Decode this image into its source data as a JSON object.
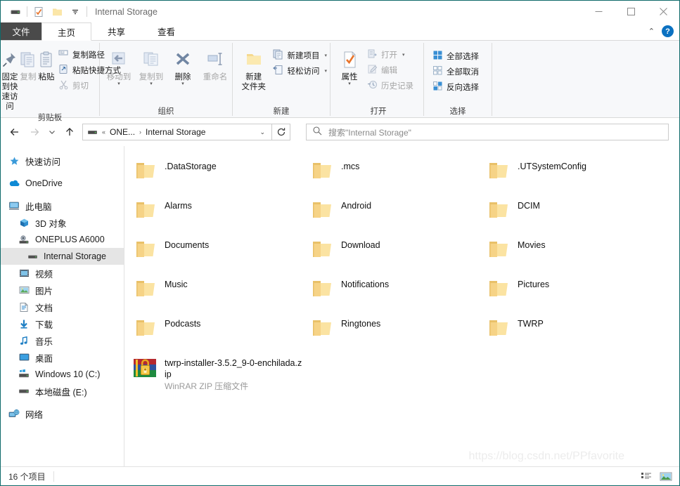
{
  "window": {
    "title": "Internal Storage",
    "quick_access": [
      "drive-icon",
      "properties-icon",
      "new-folder-icon",
      "customize-qat-icon"
    ],
    "controls": {
      "minimize": "minimize-icon",
      "maximize": "maximize-icon",
      "close": "close-icon"
    }
  },
  "tabs": {
    "file": "文件",
    "items": [
      {
        "label": "主页",
        "active": true
      },
      {
        "label": "共享",
        "active": false
      },
      {
        "label": "查看",
        "active": false
      }
    ],
    "collapse": "ribbon-collapse-icon",
    "help": "?"
  },
  "ribbon": {
    "groups": [
      {
        "label": "剪贴板",
        "big": [
          {
            "label": "固定到快\n速访问",
            "icon": "pin-icon",
            "disabled": false
          },
          {
            "label": "复制",
            "icon": "copy-icon",
            "disabled": true
          },
          {
            "label": "粘贴",
            "icon": "paste-icon",
            "disabled": false
          }
        ],
        "small": [
          {
            "label": "复制路径",
            "icon": "copy-path-icon",
            "disabled": false
          },
          {
            "label": "粘贴快捷方式",
            "icon": "paste-shortcut-icon",
            "disabled": false
          },
          {
            "label": "剪切",
            "icon": "cut-icon",
            "disabled": true
          }
        ]
      },
      {
        "label": "组织",
        "big": [
          {
            "label": "移动到",
            "icon": "move-to-icon",
            "disabled": true,
            "dropdown": true
          },
          {
            "label": "复制到",
            "icon": "copy-to-icon",
            "disabled": true,
            "dropdown": true
          },
          {
            "label": "删除",
            "icon": "delete-icon",
            "disabled": false,
            "dropdown": true
          },
          {
            "label": "重命名",
            "icon": "rename-icon",
            "disabled": true
          }
        ],
        "small": []
      },
      {
        "label": "新建",
        "big": [
          {
            "label": "新建\n文件夹",
            "icon": "new-folder-icon",
            "disabled": false
          }
        ],
        "small": [
          {
            "label": "新建项目",
            "icon": "new-item-icon",
            "disabled": false,
            "dropdown": true
          },
          {
            "label": "轻松访问",
            "icon": "easy-access-icon",
            "disabled": false,
            "dropdown": true
          }
        ]
      },
      {
        "label": "打开",
        "big": [
          {
            "label": "属性",
            "icon": "properties-icon",
            "disabled": false,
            "dropdown": true
          }
        ],
        "small": [
          {
            "label": "打开",
            "icon": "open-icon",
            "disabled": true,
            "dropdown": true
          },
          {
            "label": "编辑",
            "icon": "edit-icon",
            "disabled": true
          },
          {
            "label": "历史记录",
            "icon": "history-icon",
            "disabled": true
          }
        ]
      },
      {
        "label": "选择",
        "big": [],
        "small": [
          {
            "label": "全部选择",
            "icon": "select-all-icon",
            "disabled": false
          },
          {
            "label": "全部取消",
            "icon": "select-none-icon",
            "disabled": false
          },
          {
            "label": "反向选择",
            "icon": "invert-selection-icon",
            "disabled": false
          }
        ]
      }
    ]
  },
  "address": {
    "back": "back-arrow-icon",
    "forward": "forward-arrow-icon",
    "recent": "recent-locations-icon",
    "up": "up-arrow-icon",
    "icon": "drive-icon",
    "overflow": "«",
    "crumbs": [
      "ONE...",
      "Internal Storage"
    ],
    "separator": "›",
    "dropdown": "chevron-down-icon",
    "refresh": "refresh-icon"
  },
  "search": {
    "icon": "search-icon",
    "placeholder": "搜索\"Internal Storage\""
  },
  "sidebar": {
    "items": [
      {
        "label": "快速访问",
        "icon": "star-pin-icon",
        "indent": 0,
        "selected": false
      },
      {
        "label": "OneDrive",
        "icon": "onedrive-cloud-icon",
        "indent": 0,
        "selected": false
      },
      {
        "label": "此电脑",
        "icon": "this-pc-icon",
        "indent": 0,
        "selected": false
      },
      {
        "label": "3D 对象",
        "icon": "3d-objects-icon",
        "indent": 1,
        "selected": false
      },
      {
        "label": "ONEPLUS A6000",
        "icon": "phone-device-icon",
        "indent": 1,
        "selected": false
      },
      {
        "label": "Internal Storage",
        "icon": "drive-icon",
        "indent": 2,
        "selected": true
      },
      {
        "label": "视频",
        "icon": "videos-icon",
        "indent": 1,
        "selected": false
      },
      {
        "label": "图片",
        "icon": "pictures-icon",
        "indent": 1,
        "selected": false
      },
      {
        "label": "文档",
        "icon": "documents-icon",
        "indent": 1,
        "selected": false
      },
      {
        "label": "下载",
        "icon": "downloads-icon",
        "indent": 1,
        "selected": false
      },
      {
        "label": "音乐",
        "icon": "music-icon",
        "indent": 1,
        "selected": false
      },
      {
        "label": "桌面",
        "icon": "desktop-icon",
        "indent": 1,
        "selected": false
      },
      {
        "label": "Windows 10 (C:)",
        "icon": "windows-drive-icon",
        "indent": 1,
        "selected": false
      },
      {
        "label": "本地磁盘 (E:)",
        "icon": "drive-icon",
        "indent": 1,
        "selected": false
      },
      {
        "label": "网络",
        "icon": "network-icon",
        "indent": 0,
        "selected": false
      }
    ]
  },
  "files": [
    {
      "name": ".DataStorage",
      "type": "folder",
      "sub": ""
    },
    {
      "name": ".mcs",
      "type": "folder",
      "sub": ""
    },
    {
      "name": ".UTSystemConfig",
      "type": "folder",
      "sub": ""
    },
    {
      "name": "Alarms",
      "type": "folder",
      "sub": ""
    },
    {
      "name": "Android",
      "type": "folder",
      "sub": ""
    },
    {
      "name": "DCIM",
      "type": "folder",
      "sub": ""
    },
    {
      "name": "Documents",
      "type": "folder",
      "sub": ""
    },
    {
      "name": "Download",
      "type": "folder",
      "sub": ""
    },
    {
      "name": "Movies",
      "type": "folder",
      "sub": ""
    },
    {
      "name": "Music",
      "type": "folder",
      "sub": ""
    },
    {
      "name": "Notifications",
      "type": "folder",
      "sub": ""
    },
    {
      "name": "Pictures",
      "type": "folder",
      "sub": ""
    },
    {
      "name": "Podcasts",
      "type": "folder",
      "sub": ""
    },
    {
      "name": "Ringtones",
      "type": "folder",
      "sub": ""
    },
    {
      "name": "TWRP",
      "type": "folder",
      "sub": ""
    },
    {
      "name": "twrp-installer-3.5.2_9-0-enchilada.zip",
      "type": "zip",
      "sub": "WinRAR ZIP 压缩文件"
    }
  ],
  "watermark": "https://blog.csdn.net/PPfavorite",
  "status": {
    "count": "16 个项目",
    "views": [
      "details-view-icon",
      "large-icons-view-icon"
    ]
  },
  "colors": {
    "accent": "#0b71c1",
    "folder": "#f3d27a",
    "selection": "#e5e5e5",
    "border": "#0e6a6a"
  }
}
